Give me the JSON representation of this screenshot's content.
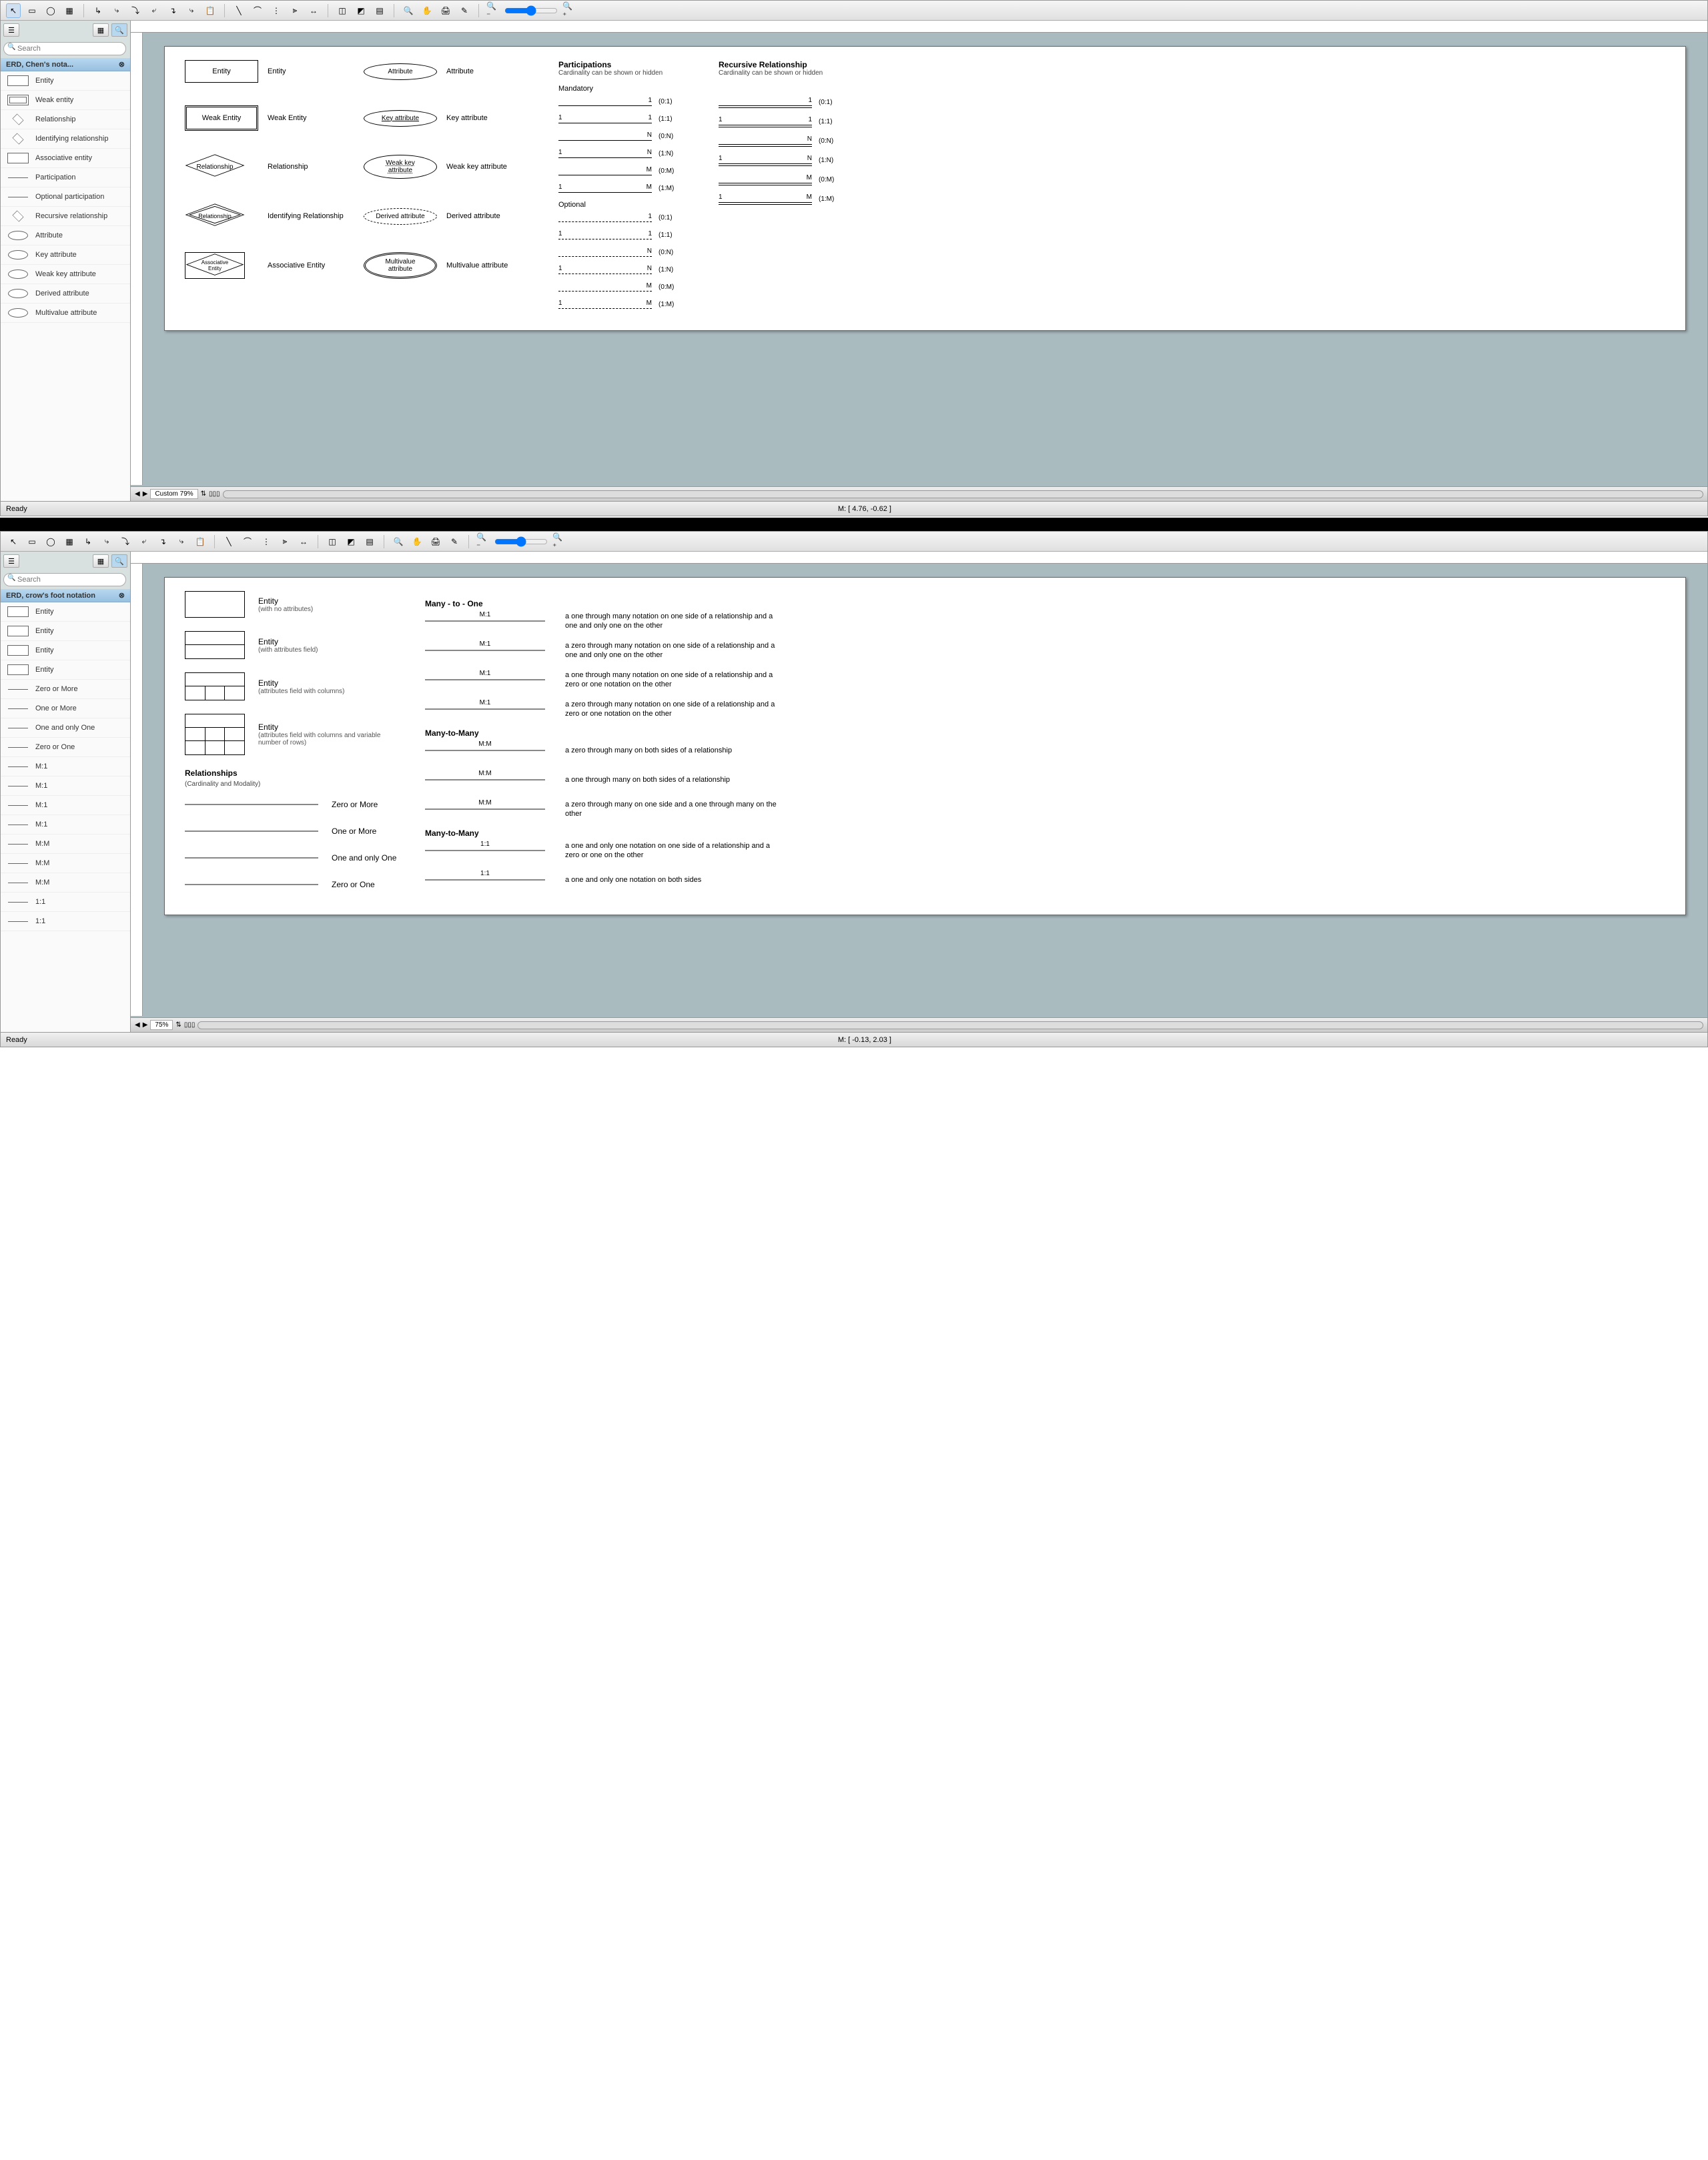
{
  "window1": {
    "search_placeholder": "Search",
    "lib_title": "ERD, Chen's nota...",
    "shapes": [
      "Entity",
      "Weak entity",
      "Relationship",
      "Identifying relationship",
      "Associative entity",
      "Participation",
      "Optional participation",
      "Recursive relationship",
      "Attribute",
      "Key attribute",
      "Weak key attribute",
      "Derived attribute",
      "Multivalue attribute"
    ],
    "page": {
      "participations_header": "Participations",
      "participations_sub": "Cardinality can be shown or hidden",
      "recursive_header": "Recursive Relationship",
      "recursive_sub": "Cardinality can be shown or hidden",
      "mandatory_label": "Mandatory",
      "optional_label": "Optional",
      "shapes": {
        "entity": "Entity",
        "entity_lbl": "Entity",
        "weak_entity": "Weak Entity",
        "weak_entity_lbl": "Weak Entity",
        "relationship": "Relationship",
        "relationship_lbl": "Relationship",
        "identifying": "Relationship",
        "identifying_lbl": "Identifying Relationship",
        "assoc": "Associative\nEntity",
        "assoc_lbl": "Associative Entity",
        "attr": "Attribute",
        "attr_lbl": "Attribute",
        "key_attr": "Key attribute",
        "key_attr_lbl": "Key attribute",
        "weak_key": "Weak key attribute",
        "weak_key_lbl": "Weak key attribute",
        "derived": "Derived attribute",
        "derived_lbl": "Derived attribute",
        "multi": "Multivalue attribute",
        "multi_lbl": "Multivalue attribute"
      },
      "mandatory_rows": [
        {
          "left": "",
          "right": "1",
          "ratio": "(0:1)",
          "r_left": "",
          "r_right": "1",
          "r_ratio": "(0:1)"
        },
        {
          "left": "1",
          "right": "1",
          "ratio": "(1:1)",
          "r_left": "1",
          "r_right": "1",
          "r_ratio": "(1:1)"
        },
        {
          "left": "",
          "right": "N",
          "ratio": "(0:N)",
          "r_left": "",
          "r_right": "N",
          "r_ratio": "(0:N)"
        },
        {
          "left": "1",
          "right": "N",
          "ratio": "(1:N)",
          "r_left": "1",
          "r_right": "N",
          "r_ratio": "(1:N)"
        },
        {
          "left": "",
          "right": "M",
          "ratio": "(0:M)",
          "r_left": "",
          "r_right": "M",
          "r_ratio": "(0:M)"
        },
        {
          "left": "1",
          "right": "M",
          "ratio": "(1:M)",
          "r_left": "1",
          "r_right": "M",
          "r_ratio": "(1:M)"
        }
      ],
      "optional_rows": [
        {
          "left": "",
          "right": "1",
          "ratio": "(0:1)"
        },
        {
          "left": "1",
          "right": "1",
          "ratio": "(1:1)"
        },
        {
          "left": "",
          "right": "N",
          "ratio": "(0:N)"
        },
        {
          "left": "1",
          "right": "N",
          "ratio": "(1:N)"
        },
        {
          "left": "",
          "right": "M",
          "ratio": "(0:M)"
        },
        {
          "left": "1",
          "right": "M",
          "ratio": "(1:M)"
        }
      ]
    },
    "zoom_label": "Custom 79%",
    "mouse_pos": "M: [ 4.76, -0.62 ]",
    "status": "Ready"
  },
  "window2": {
    "search_placeholder": "Search",
    "lib_title": "ERD, crow's foot notation",
    "shapes": [
      "Entity",
      "Entity",
      "Entity",
      "Entity",
      "Zero or More",
      "One or More",
      "One and only One",
      "Zero or One",
      "M:1",
      "M:1",
      "M:1",
      "M:1",
      "M:M",
      "M:M",
      "M:M",
      "1:1",
      "1:1"
    ],
    "page": {
      "entities": [
        {
          "title": "Entity",
          "sub": "(with no attributes)"
        },
        {
          "title": "Entity",
          "sub": "(with attributes field)"
        },
        {
          "title": "Entity",
          "sub": "(attributes field with columns)"
        },
        {
          "title": "Entity",
          "sub": "(attributes field with columns and variable number of rows)"
        }
      ],
      "rel_header": "Relationships",
      "rel_sub": "(Cardinality and Modality)",
      "cardinality_basics": [
        {
          "label": "Zero or More"
        },
        {
          "label": "One or More"
        },
        {
          "label": "One and only One"
        },
        {
          "label": "Zero or One"
        }
      ],
      "many_to_one_header": "Many - to - One",
      "m1_rows": [
        {
          "label": "M:1",
          "desc": "a one through many notation on one side of a relationship and a one and only one on the other"
        },
        {
          "label": "M:1",
          "desc": "a zero through many notation on one side of a relationship and a one and only one on the other"
        },
        {
          "label": "M:1",
          "desc": "a one through many notation on one side of a relationship and a zero or one notation on the other"
        },
        {
          "label": "M:1",
          "desc": "a zero through many notation on one side of a relationship and a zero or one notation on the other"
        }
      ],
      "many_to_many_header": "Many-to-Many",
      "mm_rows": [
        {
          "label": "M:M",
          "desc": "a zero through many on both sides of a relationship"
        },
        {
          "label": "M:M",
          "desc": "a one through many on both sides of a relationship"
        },
        {
          "label": "M:M",
          "desc": "a zero through many on one side and a one through many on the other"
        }
      ],
      "one_to_one_header": "Many-to-Many",
      "oo_rows": [
        {
          "label": "1:1",
          "desc": "a one and only one notation on one side of a relationship and a zero or one on the other"
        },
        {
          "label": "1:1",
          "desc": "a one and only one notation on both sides"
        }
      ]
    },
    "zoom_label": "75%",
    "mouse_pos": "M: [ -0.13, 2.03 ]",
    "status": "Ready"
  }
}
